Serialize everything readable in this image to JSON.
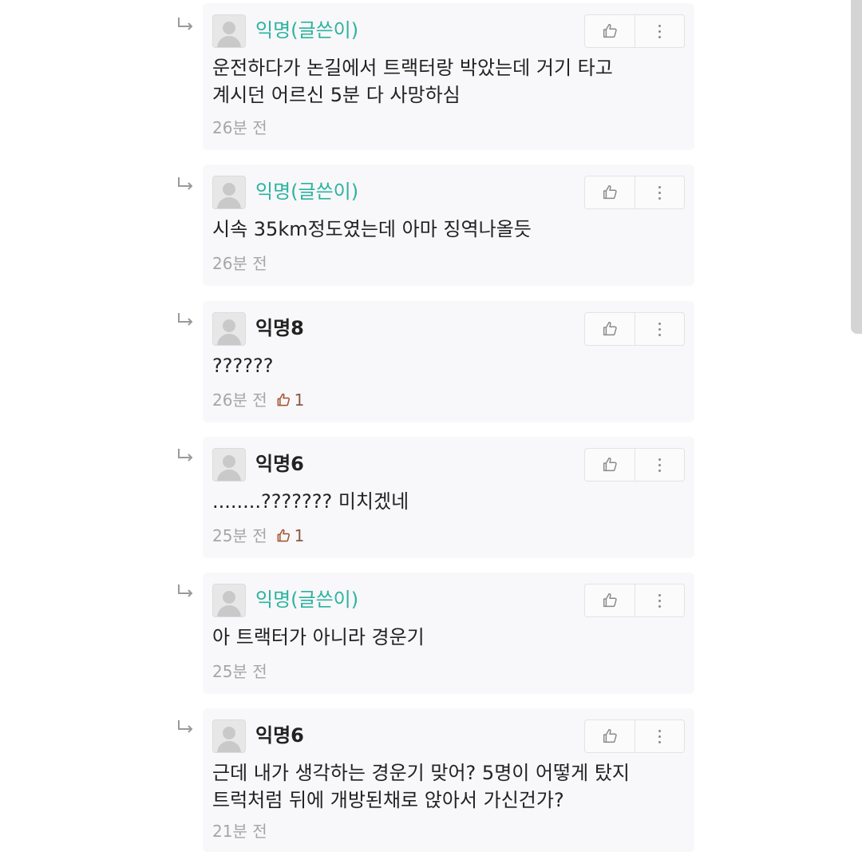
{
  "comments": [
    {
      "author": "익명(글쓴이)",
      "is_op": true,
      "text": "운전하다가 논길에서 트랙터랑 박았는데 거기 타고\n계시던 어르신 5분 다 사망하심",
      "time": "26분 전",
      "likes": ""
    },
    {
      "author": "익명(글쓴이)",
      "is_op": true,
      "text": "시속 35km정도였는데 아마 징역나올듯",
      "time": "26분 전",
      "likes": ""
    },
    {
      "author": "익명8",
      "is_op": false,
      "text": "??????",
      "time": "26분 전",
      "likes": "1"
    },
    {
      "author": "익명6",
      "is_op": false,
      "text": "........??????? 미치겠네",
      "time": "25분 전",
      "likes": "1"
    },
    {
      "author": "익명(글쓴이)",
      "is_op": true,
      "text": "아 트랙터가 아니라 경운기",
      "time": "25분 전",
      "likes": ""
    },
    {
      "author": "익명6",
      "is_op": false,
      "text": "근데 내가 생각하는 경운기 맞어? 5명이 어떻게 탔지\n트럭처럼 뒤에 개방된채로 앉아서 가신건가?",
      "time": "21분 전",
      "likes": ""
    }
  ],
  "icons": {
    "reply": "reply-arrow-icon",
    "like": "thumbs-up-icon",
    "more": "more-vertical-icon",
    "avatar": "default-avatar-icon"
  },
  "colors": {
    "op_name": "#2bb3a0",
    "like_count": "#8a5a4a"
  }
}
